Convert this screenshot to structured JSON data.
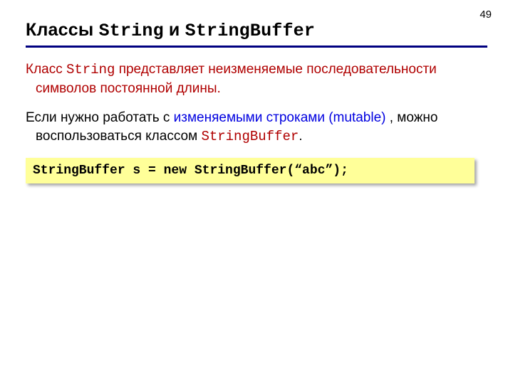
{
  "page_number": "49",
  "title": {
    "prefix": "Классы ",
    "code1": "String",
    "mid": " и ",
    "code2": "StringBuffer"
  },
  "para1": {
    "t1": "Класс ",
    "code": "String",
    "t2": " представляет неизменяемые последовательности символов постоянной длины."
  },
  "para2": {
    "t1": "Если нужно работать с ",
    "blue": "изменяемыми строками (mutable)",
    "t2": " , можно воспользоваться классом ",
    "code": "StringBuffer",
    "t3": "."
  },
  "codebox": "StringBuffer s = new StringBuffer(“abc”);"
}
